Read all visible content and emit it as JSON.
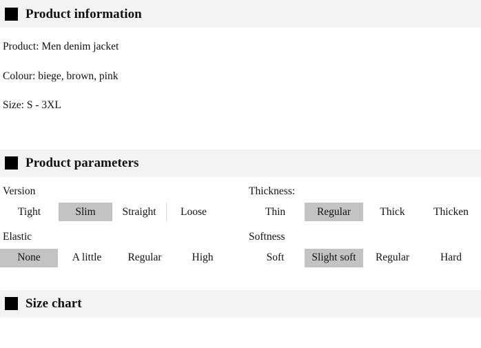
{
  "sections": [
    {
      "id": "product-information",
      "marker": "black-square-marker",
      "title": "Product information"
    },
    {
      "id": "product-parameters",
      "marker": "black-square-marker",
      "title": "Product parameters"
    },
    {
      "id": "size-chart",
      "marker": "black-square-marker",
      "title": "Size chart"
    }
  ],
  "product_information": {
    "lines": [
      "Product: Men denim jacket",
      "Colour: biege, brown, pink",
      "Size: S - 3XL"
    ]
  },
  "product_parameters": {
    "groups": [
      {
        "label": "Version",
        "options": [
          {
            "text": "Tight",
            "selected": false
          },
          {
            "text": "Slim",
            "selected": true
          },
          {
            "text": "Straight",
            "selected": false
          },
          {
            "text": "Loose",
            "selected": false
          }
        ],
        "divider_after_index": 2
      },
      {
        "label": "Thickness:",
        "options": [
          {
            "text": "Thin",
            "selected": false
          },
          {
            "text": "Regular",
            "selected": true
          },
          {
            "text": "Thick",
            "selected": false
          },
          {
            "text": "Thicken",
            "selected": false
          }
        ],
        "divider_after_index": -1
      },
      {
        "label": "Elastic",
        "options": [
          {
            "text": "None",
            "selected": true
          },
          {
            "text": "A little",
            "selected": false
          },
          {
            "text": "Regular",
            "selected": false
          },
          {
            "text": "High",
            "selected": false
          }
        ],
        "divider_after_index": -1
      },
      {
        "label": "Softness",
        "options": [
          {
            "text": "Soft",
            "selected": false
          },
          {
            "text": "Slight soft",
            "selected": true
          },
          {
            "text": "Regular",
            "selected": false
          },
          {
            "text": "Hard",
            "selected": false
          }
        ],
        "divider_after_index": -1
      }
    ]
  },
  "colors": {
    "band_background": "#f2f3f3",
    "marker": "#000000",
    "chip_selected_background": "#c3c3c3",
    "divider": "#d8d8d8",
    "page_background": "#ffffff",
    "text": "#111111"
  }
}
